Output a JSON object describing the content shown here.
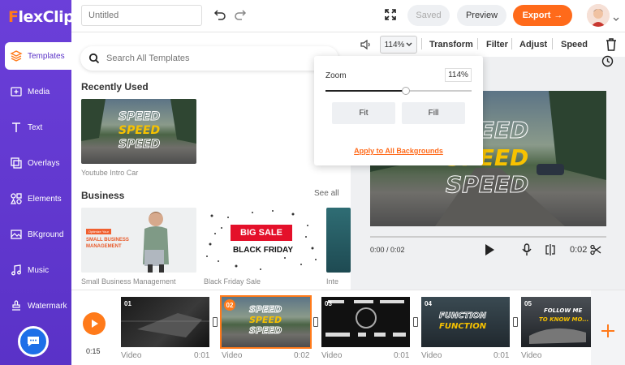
{
  "app": {
    "logo": "FlexClip",
    "logo_prefix": "F",
    "logo_rest": "lexClip"
  },
  "colors": {
    "brand_purple": "#5a32c7",
    "accent_orange": "#ff6a1a"
  },
  "sidebar": {
    "items": [
      {
        "label": "Templates",
        "icon": "templates-icon",
        "active": true
      },
      {
        "label": "Media",
        "icon": "media-icon"
      },
      {
        "label": "Text",
        "icon": "text-icon"
      },
      {
        "label": "Overlays",
        "icon": "overlays-icon"
      },
      {
        "label": "Elements",
        "icon": "elements-icon"
      },
      {
        "label": "BKground",
        "icon": "background-icon"
      },
      {
        "label": "Music",
        "icon": "music-icon"
      },
      {
        "label": "Watermark",
        "icon": "watermark-icon"
      }
    ]
  },
  "topbar": {
    "title_placeholder": "Untitled",
    "saved_label": "Saved",
    "preview_label": "Preview",
    "export_label": "Export",
    "export_arrow": "→"
  },
  "templates": {
    "search_placeholder": "Search All Templates",
    "recent_title": "Recently Used",
    "recent_item_name": "Youtube Intro Car",
    "business_title": "Business",
    "see_all": "See all",
    "business_items": [
      {
        "name": "Small Business Management",
        "tag": "Optimize Your",
        "headline": "SMALL BUSINESS MANAGEMENT"
      },
      {
        "name": "Black Friday Sale",
        "line1": "BIG SALE",
        "line2": "BLACK FRIDAY"
      },
      {
        "name": "Inte"
      }
    ],
    "speed_word": "SPEED"
  },
  "editor_toolbar": {
    "zoom_value": "114%",
    "transform": "Transform",
    "filter": "Filter",
    "adjust": "Adjust",
    "speed": "Speed"
  },
  "zoom_popup": {
    "label": "Zoom",
    "value": "114%",
    "slider_fraction": 0.55,
    "fit": "Fit",
    "fill": "Fill",
    "apply_all": "Apply to All Backgrounds"
  },
  "player": {
    "time": "0:00 / 0:02",
    "duration": "0:02"
  },
  "timeline": {
    "total": "0:15",
    "clips": [
      {
        "num": "01",
        "label": "Video",
        "dur": "0:01"
      },
      {
        "num": "02",
        "label": "Video",
        "dur": "0:02",
        "selected": true
      },
      {
        "num": "03",
        "label": "Video",
        "dur": "0:01"
      },
      {
        "num": "04",
        "label": "Video",
        "dur": "0:01",
        "text": "FUNCTION"
      },
      {
        "num": "05",
        "label": "Video",
        "dur": "",
        "line1": "FOLLOW ME",
        "line2": "TO KNOW MO..."
      }
    ]
  }
}
